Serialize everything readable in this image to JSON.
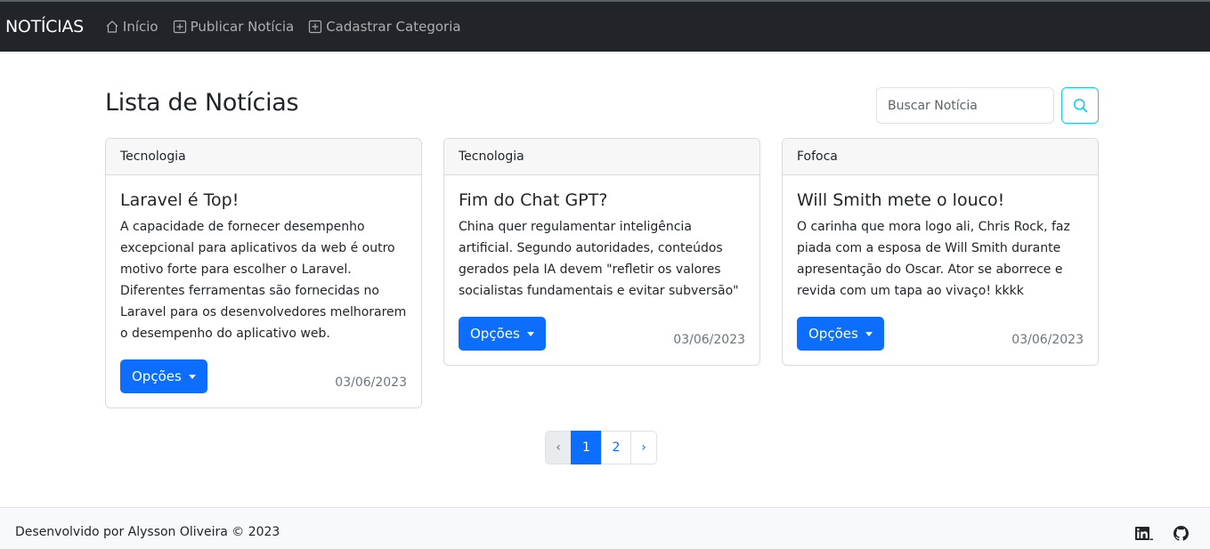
{
  "navbar": {
    "brand": "NOTÍCIAS",
    "links": [
      {
        "label": "Início",
        "icon": "home-icon"
      },
      {
        "label": "Publicar Notícia",
        "icon": "plus-square-icon"
      },
      {
        "label": "Cadastrar Categoria",
        "icon": "plus-square-icon"
      }
    ]
  },
  "main": {
    "title": "Lista de Notícias",
    "search": {
      "placeholder": "Buscar Notícia",
      "value": "",
      "button_icon": "search-icon"
    }
  },
  "cards": [
    {
      "category": "Tecnologia",
      "title": "Laravel é Top!",
      "text": "A capacidade de fornecer desempenho excepcional para aplicativos da web é outro motivo forte para escolher o Laravel. Diferentes ferramentas são fornecidas no Laravel para os desenvolvedores melhorarem o desempenho do aplicativo web.",
      "button": "Opções",
      "date": "03/06/2023"
    },
    {
      "category": "Tecnologia",
      "title": "Fim do Chat GPT?",
      "text": "China quer regulamentar inteligência artificial. Segundo autoridades, conteúdos gerados pela IA devem \"refletir os valores socialistas fundamentais e evitar subversão\"",
      "button": "Opções",
      "date": "03/06/2023"
    },
    {
      "category": "Fofoca",
      "title": "Will Smith mete o louco!",
      "text": "O carinha que mora logo ali, Chris Rock, faz piada com a esposa de Will Smith durante apresentação do Oscar. Ator se aborrece e revida com um tapa ao vivaço! kkkk",
      "button": "Opções",
      "date": "03/06/2023"
    }
  ],
  "pagination": {
    "prev": "‹",
    "pages": [
      "1",
      "2"
    ],
    "active": "1",
    "next": "›"
  },
  "footer": {
    "text": "Desenvolvido por Alysson Oliveira © 2023",
    "icons": [
      "linkedin-icon",
      "github-icon"
    ]
  },
  "colors": {
    "navbar_bg": "#212529",
    "primary": "#0d6efd",
    "search_border": "#0dcaf0",
    "footer_bg": "#f8f9fa"
  }
}
